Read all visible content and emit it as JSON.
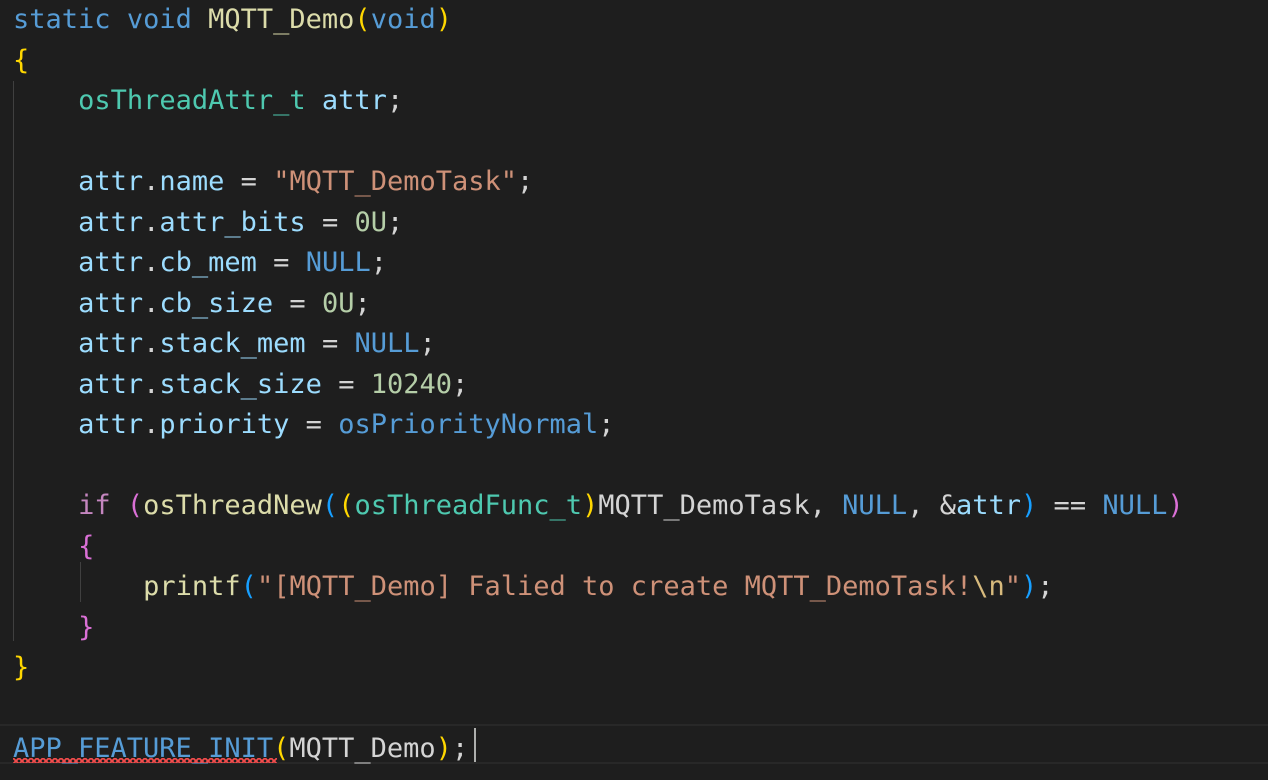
{
  "editor": {
    "language": "c",
    "function_name": "MQTT_Demo",
    "code_lines": [
      "static void MQTT_Demo(void)",
      "{",
      "    osThreadAttr_t attr;",
      "",
      "    attr.name = \"MQTT_DemoTask\";",
      "    attr.attr_bits = 0U;",
      "    attr.cb_mem = NULL;",
      "    attr.cb_size = 0U;",
      "    attr.stack_mem = NULL;",
      "    attr.stack_size = 10240;",
      "    attr.priority = osPriorityNormal;",
      "",
      "    if (osThreadNew((osThreadFunc_t)MQTT_DemoTask, NULL, &attr) == NULL)",
      "    {",
      "        printf(\"[MQTT_Demo] Falied to create MQTT_DemoTask!\\n\");",
      "    }",
      "}",
      "",
      "APP_FEATURE_INIT(MQTT_Demo);"
    ],
    "error_squiggle_on": "APP_FEATURE_INIT",
    "cursor_after": "APP_FEATURE_INIT(MQTT_Demo);"
  },
  "colors": {
    "background": "#1e1e1e",
    "keyword": "#569cd6",
    "control": "#c586c0",
    "function": "#dcdcaa",
    "type": "#4ec9b0",
    "variable": "#9cdcfe",
    "string": "#ce9178",
    "number": "#b5cea8",
    "error": "#f14c4c"
  }
}
